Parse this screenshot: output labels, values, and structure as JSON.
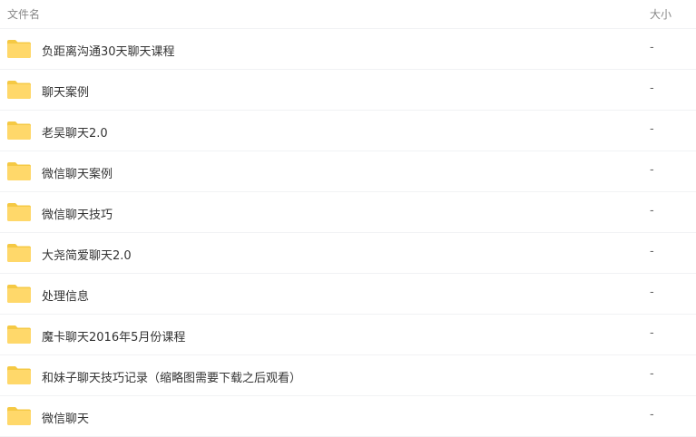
{
  "header": {
    "name_label": "文件名",
    "size_label": "大小"
  },
  "colors": {
    "folder": "#ffd86a",
    "folder_tab": "#f5c944",
    "divider": "#f1f2f4"
  },
  "files": [
    {
      "name": "负距离沟通30天聊天课程",
      "size": "-",
      "icon": "folder-icon"
    },
    {
      "name": "聊天案例",
      "size": "-",
      "icon": "folder-icon"
    },
    {
      "name": "老吴聊天2.0",
      "size": "-",
      "icon": "folder-icon"
    },
    {
      "name": "微信聊天案例",
      "size": "-",
      "icon": "folder-icon"
    },
    {
      "name": "微信聊天技巧",
      "size": "-",
      "icon": "folder-icon"
    },
    {
      "name": "大尧简爱聊天2.0",
      "size": "-",
      "icon": "folder-icon"
    },
    {
      "name": "处理信息",
      "size": "-",
      "icon": "folder-icon"
    },
    {
      "name": "魔卡聊天2016年5月份课程",
      "size": "-",
      "icon": "folder-icon"
    },
    {
      "name": "和妹子聊天技巧记录（缩略图需要下载之后观看）",
      "size": "-",
      "icon": "folder-icon"
    },
    {
      "name": "微信聊天",
      "size": "-",
      "icon": "folder-icon"
    }
  ]
}
